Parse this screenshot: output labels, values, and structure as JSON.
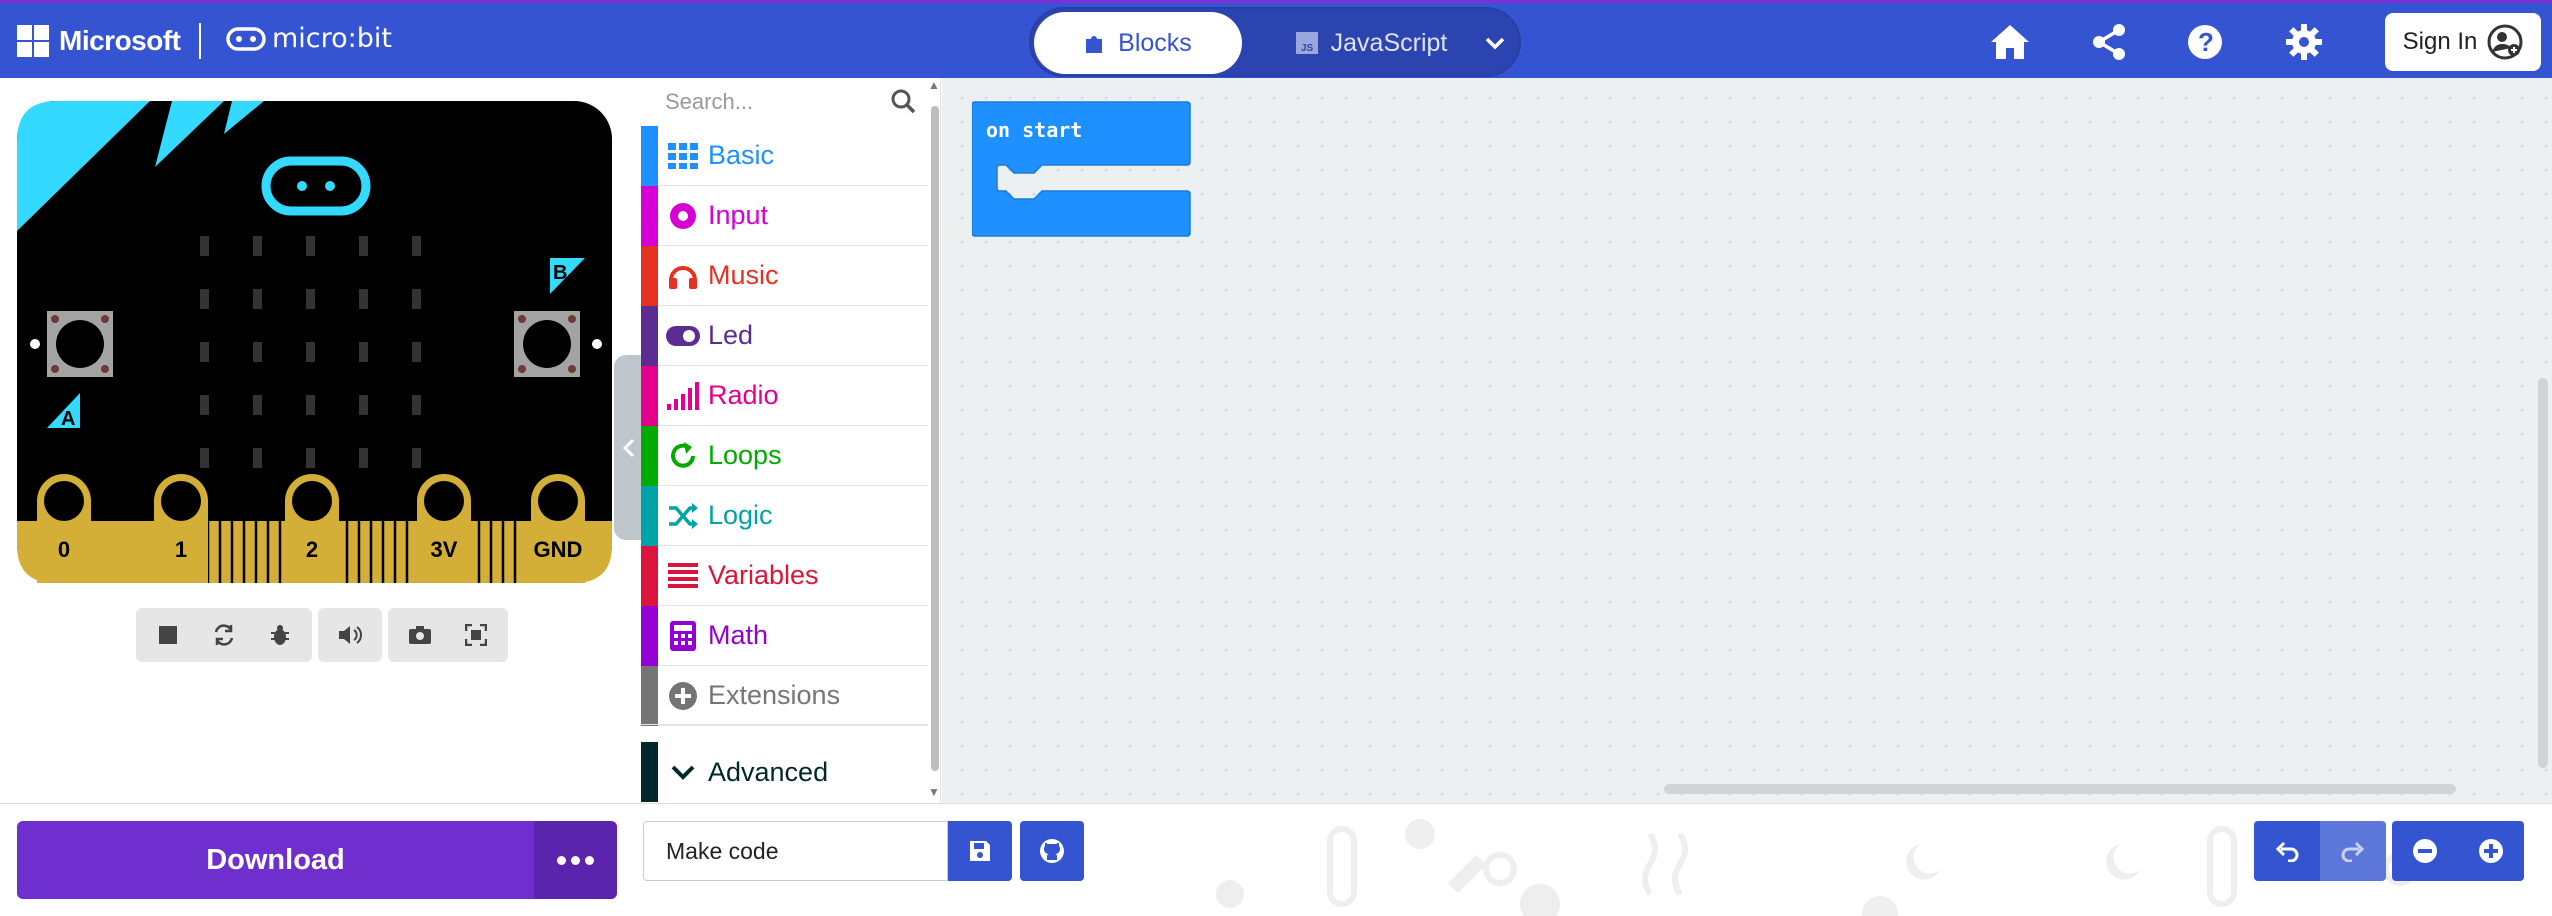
{
  "header": {
    "brand": "Microsoft",
    "product": "micro:bit",
    "tabs": [
      {
        "label": "Blocks",
        "active": true
      },
      {
        "label": "JavaScript",
        "active": false
      }
    ],
    "icons": [
      "home-icon",
      "share-icon",
      "help-icon",
      "settings-icon"
    ],
    "sign_in_label": "Sign In",
    "colors": {
      "bar": "#3454d1",
      "accent_top": "#7e2fd6"
    }
  },
  "simulator": {
    "pins": [
      "0",
      "1",
      "2",
      "3V",
      "GND"
    ],
    "button_a": "A",
    "button_b": "B",
    "toolbar_icons": [
      "stop-icon",
      "restart-icon",
      "debug-icon",
      "mute-icon",
      "screenshot-icon",
      "fullscreen-icon"
    ]
  },
  "toolbox": {
    "search_placeholder": "Search...",
    "categories": [
      {
        "label": "Basic",
        "color": "#1e90ff",
        "icon": "grid-icon"
      },
      {
        "label": "Input",
        "color": "#d400d4",
        "icon": "target-icon"
      },
      {
        "label": "Music",
        "color": "#e63022",
        "icon": "headphones-icon"
      },
      {
        "label": "Led",
        "color": "#5c2d91",
        "icon": "toggle-icon"
      },
      {
        "label": "Radio",
        "color": "#e3008c",
        "icon": "signal-icon"
      },
      {
        "label": "Loops",
        "color": "#00aa00",
        "icon": "loop-icon"
      },
      {
        "label": "Logic",
        "color": "#00a4a6",
        "icon": "shuffle-icon"
      },
      {
        "label": "Variables",
        "color": "#dc143c",
        "icon": "lines-icon"
      },
      {
        "label": "Math",
        "color": "#9400d3",
        "icon": "calculator-icon"
      },
      {
        "label": "Extensions",
        "color": "#757575",
        "icon": "plus-circle-icon"
      },
      {
        "label": "Advanced",
        "color": "#00272b",
        "icon": "chevron-down-icon"
      }
    ]
  },
  "workspace": {
    "block_label": "on start",
    "block_color": "#1e90ff"
  },
  "footer": {
    "download_label": "Download",
    "project_name": "Make code",
    "buttons": [
      "save-icon",
      "github-icon",
      "undo-icon",
      "redo-icon",
      "zoom-out-icon",
      "zoom-in-icon"
    ]
  }
}
